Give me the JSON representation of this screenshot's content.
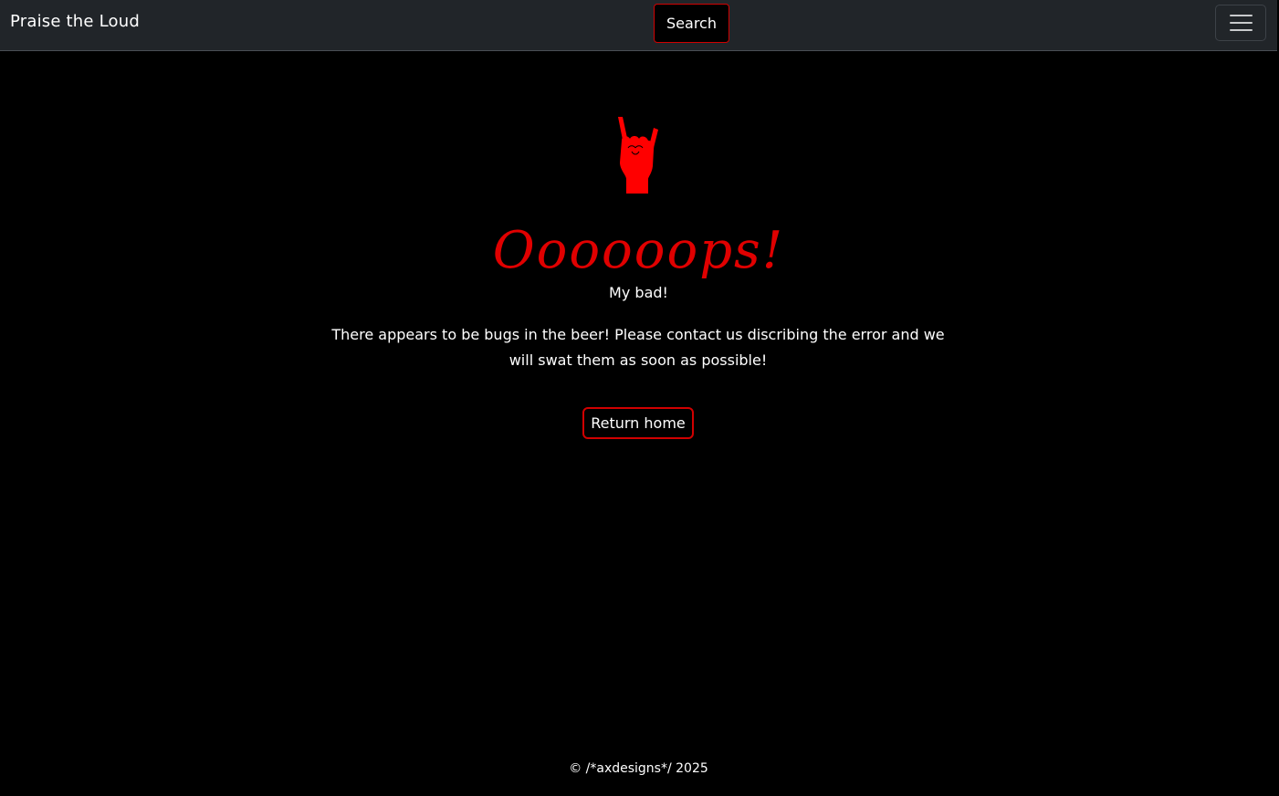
{
  "navbar": {
    "brand": "Praise the Loud",
    "search_label": "Search",
    "menu_icon": "hamburger-menu-icon"
  },
  "main": {
    "hero_icon": "rock-hand-icon",
    "title": "Oooooops!",
    "subtitle": "My bad!",
    "message": "There appears to be bugs in the beer! Please contact us discribing the error and we will swat them as soon as possible!",
    "return_label": "Return home"
  },
  "footer": {
    "text": "© /*axdesigns*/ 2025"
  },
  "colors": {
    "accent": "#e00000",
    "navbar_bg": "#212529",
    "page_bg": "#000000"
  }
}
